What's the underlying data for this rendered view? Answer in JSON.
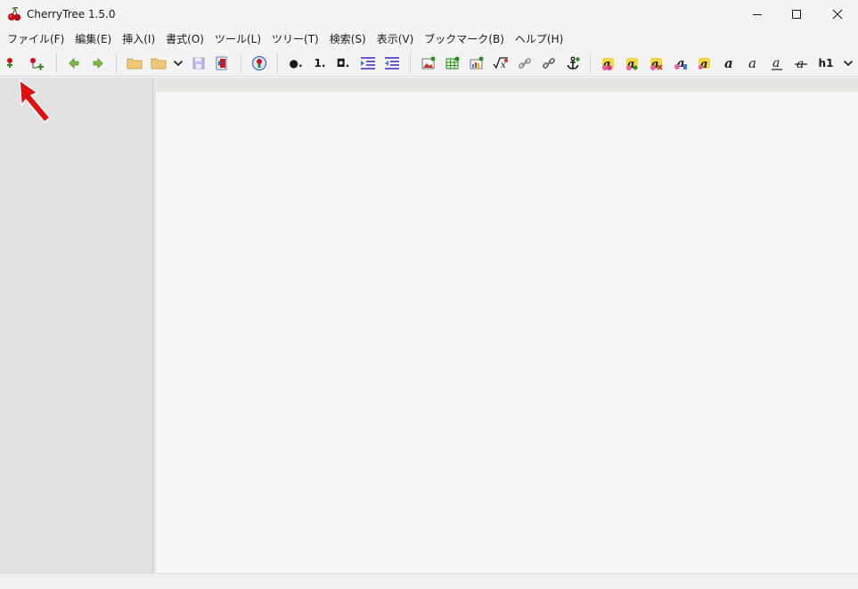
{
  "window": {
    "title": "CherryTree 1.5.0"
  },
  "menu": [
    {
      "label": "ファイル(F)"
    },
    {
      "label": "編集(E)"
    },
    {
      "label": "挿入(I)"
    },
    {
      "label": "書式(O)"
    },
    {
      "label": "ツール(L)"
    },
    {
      "label": "ツリー(T)"
    },
    {
      "label": "検索(S)"
    },
    {
      "label": "表示(V)"
    },
    {
      "label": "ブックマーク(B)"
    },
    {
      "label": "ヘルプ(H)"
    }
  ],
  "toolbar": {
    "bullet_label": "●.",
    "number_label": "1.",
    "todo_label": "◘.",
    "h1_label": "h1",
    "icons": [
      "add-node-icon",
      "add-subnode-icon",
      "back-icon",
      "forward-icon",
      "open-folder-icon",
      "recent-folder-icon",
      "chevron-down-icon",
      "save-icon",
      "export-icon",
      "node-properties-icon",
      "bulleted-list-icon",
      "numbered-list-icon",
      "todo-list-icon",
      "indent-icon",
      "unindent-icon",
      "insert-image-icon",
      "insert-table-icon",
      "insert-codebox-icon",
      "insert-latex-icon",
      "insert-link-icon",
      "insert-chain-link-icon",
      "insert-anchor-icon",
      "text-color-fg-icon",
      "text-color-bg-icon",
      "remove-format-icon",
      "highlight-small-icon",
      "highlight-yellow-icon",
      "bold-icon",
      "italic-icon",
      "underline-icon",
      "strikethrough-icon",
      "heading1-label",
      "more-chevron-icon"
    ]
  },
  "colors": {
    "titlebar": "#f3f3f3",
    "tree_bg": "#e1e1e1",
    "editor_bg": "#f9f8f6",
    "annotation_arrow": "#e01010"
  }
}
